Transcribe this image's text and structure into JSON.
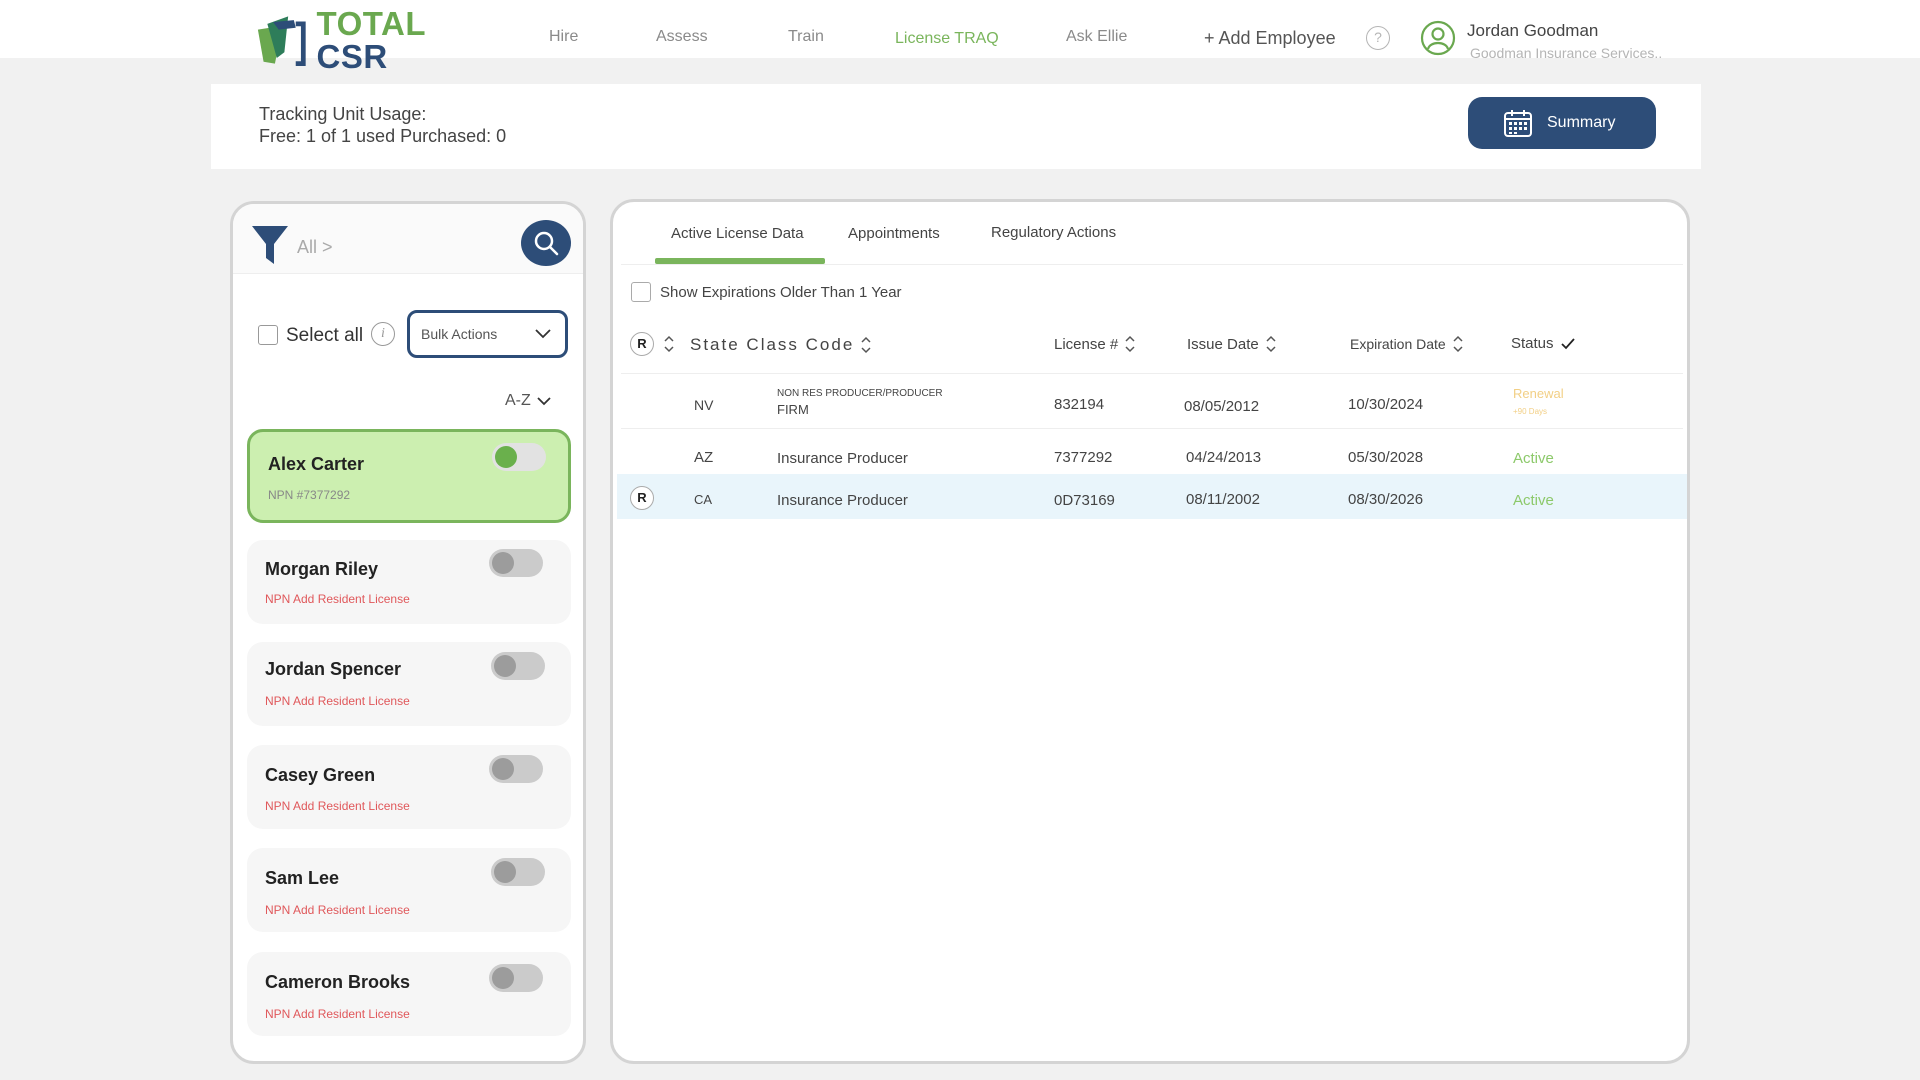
{
  "header": {
    "logo_text": "TOTAL CSR",
    "nav": [
      "Hire",
      "Assess",
      "Train",
      "License TRAQ",
      "Ask Ellie"
    ],
    "active_nav": "License TRAQ",
    "add_employee": "+ Add Employee",
    "help": "?",
    "user_name": "Jordan Goodman",
    "user_company": "Goodman Insurance Services.."
  },
  "tracking": {
    "line1": "Tracking Unit Usage:",
    "line2": "Free: 1 of 1 used Purchased: 0",
    "summary_label": "Summary"
  },
  "left": {
    "filter_label": "All >",
    "select_all": "Select all",
    "info": "i",
    "bulk_actions": "Bulk Actions",
    "sort": "A-Z",
    "employees": [
      {
        "name": "Alex Carter",
        "sub": "NPN #7377292",
        "selected": true,
        "toggle_on": true
      },
      {
        "name": "Morgan Riley",
        "sub": "NPN Add Resident License",
        "selected": false,
        "toggle_on": false
      },
      {
        "name": "Jordan Spencer",
        "sub": "NPN Add Resident License",
        "selected": false,
        "toggle_on": false
      },
      {
        "name": "Casey Green",
        "sub": "NPN Add Resident License",
        "selected": false,
        "toggle_on": false
      },
      {
        "name": "Sam Lee",
        "sub": "NPN Add Resident License",
        "selected": false,
        "toggle_on": false
      },
      {
        "name": "Cameron Brooks",
        "sub": "NPN Add Resident License",
        "selected": false,
        "toggle_on": false
      }
    ]
  },
  "right": {
    "tabs": [
      "Active License Data",
      "Appointments",
      "Regulatory Actions"
    ],
    "active_tab": "Active License Data",
    "show_expirations": "Show Expirations Older Than 1 Year",
    "columns": {
      "r": "R",
      "state_class_code": "State Class Code",
      "license": "License #",
      "issue": "Issue Date",
      "expiration": "Expiration Date",
      "status": "Status"
    },
    "rows": [
      {
        "r": "",
        "state": "NV",
        "class_line1": "NON RES PRODUCER/PRODUCER",
        "class_line2": "FIRM",
        "license": "832194",
        "issue": "08/05/2012",
        "expiration": "10/30/2024",
        "status": "Renewal",
        "status_sub": "+90 Days"
      },
      {
        "r": "",
        "state": "AZ",
        "class_line1": "Insurance Producer",
        "class_line2": "",
        "license": "7377292",
        "issue": "04/24/2013",
        "expiration": "05/30/2028",
        "status": "Active",
        "status_sub": ""
      },
      {
        "r": "R",
        "state": "CA",
        "class_line1": "Insurance Producer",
        "class_line2": "",
        "license": "0D73169",
        "issue": "08/11/2002",
        "expiration": "08/30/2026",
        "status": "Active",
        "status_sub": ""
      }
    ]
  },
  "colors": {
    "brand_navy": "#2d4d78",
    "brand_green": "#7ab55c",
    "selected_card": "#ccefb0",
    "warning_red": "#e0585b",
    "renewal_yellow": "#f2cf85",
    "active_green": "#8cc96a"
  }
}
